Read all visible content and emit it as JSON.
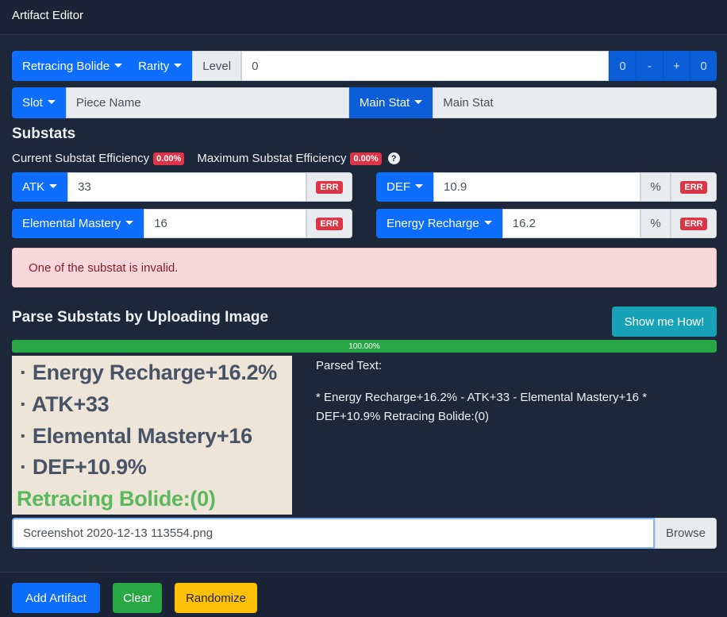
{
  "app": {
    "title": "Artifact Editor"
  },
  "top_row": {
    "set_label": "Retracing Bolide",
    "rarity_label": "Rarity",
    "level_label": "Level",
    "level_value": "0",
    "btn_zero_left": "0",
    "btn_minus": "-",
    "btn_plus": "+",
    "btn_zero_right": "0"
  },
  "second_row": {
    "slot_label": "Slot",
    "piece_name_placeholder": "Piece Name",
    "main_stat_label": "Main Stat",
    "main_stat_value": "Main Stat"
  },
  "substats": {
    "heading": "Substats",
    "current_label": "Current Substat Efficiency",
    "current_value": "0.00%",
    "max_label": "Maximum Substat Efficiency",
    "max_value": "0.00%",
    "help_icon": "question-circle-icon",
    "items": [
      {
        "stat": "ATK",
        "value": "33",
        "unit": "",
        "status": "ERR"
      },
      {
        "stat": "DEF",
        "value": "10.9",
        "unit": "%",
        "status": "ERR"
      },
      {
        "stat": "Elemental Mastery",
        "value": "16",
        "unit": "",
        "status": "ERR"
      },
      {
        "stat": "Energy Recharge",
        "value": "16.2",
        "unit": "%",
        "status": "ERR"
      }
    ],
    "alert": "One of the substat is invalid."
  },
  "parse": {
    "heading": "Parse Substats by Uploading Image",
    "show_me_how": "Show me How!",
    "progress_text": "100.00%",
    "progress_value": 1.0,
    "image_lines": [
      "· Energy Recharge+16.2%",
      "· ATK+33",
      "· Elemental Mastery+16",
      "· DEF+10.9%",
      "Retracing Bolide:(0)"
    ],
    "parsed_title": "Parsed Text:",
    "parsed_line1": "* Energy Recharge+16.2% - ATK+33 - Elemental Mastery+16 *",
    "parsed_line2": "DEF+10.9% Retracing Bolide:(0)",
    "file_name": "Screenshot 2020-12-13 113554.png",
    "browse_label": "Browse"
  },
  "footer": {
    "add_label": "Add Artifact",
    "clear_label": "Clear",
    "randomize_label": "Randomize"
  },
  "colors": {
    "background": "#1d273a",
    "primary": "#0d6efd",
    "danger": "#dc3545",
    "success": "#28a745",
    "info": "#17a2b8",
    "warning": "#ffc107"
  }
}
